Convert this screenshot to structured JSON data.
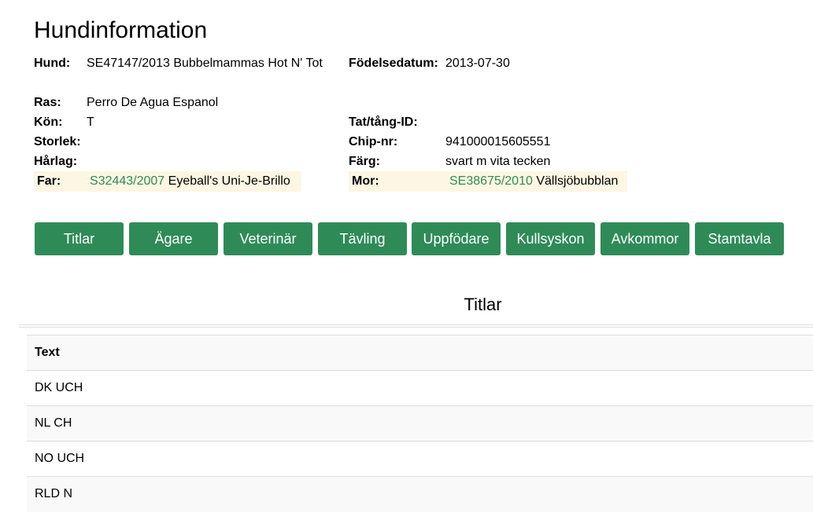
{
  "page_title": "Hundinformation",
  "dog": {
    "name_label": "Hund:",
    "name_value": "SE47147/2013 Bubbelmammas Hot N' Tot",
    "birth_label": "Födelsedatum:",
    "birth_value": "2013-07-30",
    "breed_label": "Ras:",
    "breed_value": "Perro De Agua Espanol",
    "sex_label": "Kön:",
    "sex_value": "T",
    "tattoo_label": "Tat/tång-ID:",
    "tattoo_value": "",
    "size_label": "Storlek:",
    "size_value": "",
    "chip_label": "Chip-nr:",
    "chip_value": "941000015605551",
    "coat_label": "Hårlag:",
    "coat_value": "",
    "color_label": "Färg:",
    "color_value": "svart m vita tecken",
    "sire_label": "Far:",
    "sire_reg": "S32443/2007",
    "sire_name": "Eyeball's Uni-Je-Brillo",
    "dam_label": "Mor:",
    "dam_reg": "SE38675/2010",
    "dam_name": "Vällsjöbubblan"
  },
  "buttons": {
    "titlar": "Titlar",
    "agare": "Ägare",
    "veterinar": "Veterinär",
    "tavling": "Tävling",
    "uppfodare": "Uppfödare",
    "kullsyskon": "Kullsyskon",
    "avkommor": "Avkommor",
    "stamtavla": "Stamtavla"
  },
  "section": {
    "title": "Titlar",
    "column_header": "Text",
    "rows": [
      "DK UCH",
      "NL CH",
      "NO UCH",
      "RLD N"
    ]
  },
  "colors": {
    "accent": "#2e8b57",
    "highlight": "#fdf6e3"
  }
}
